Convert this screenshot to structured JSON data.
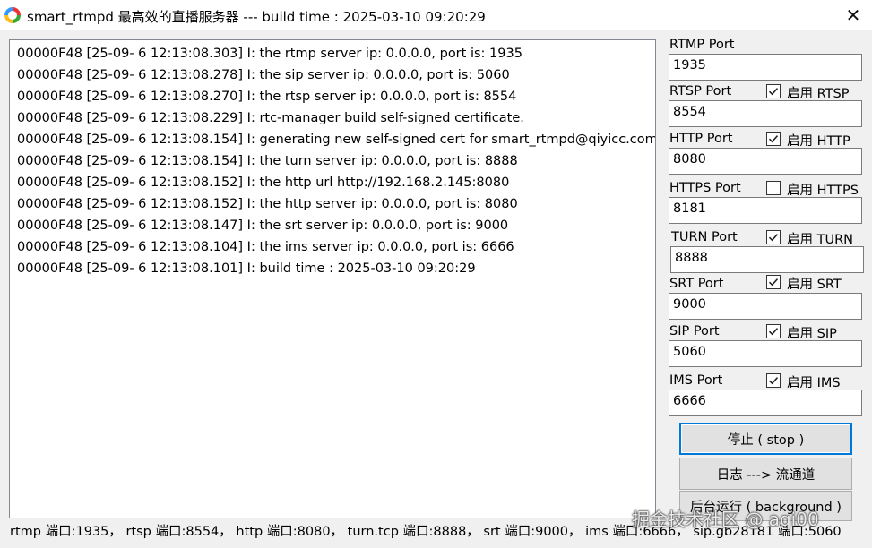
{
  "window": {
    "title": "smart_rtmpd 最高效的直播服务器 --- build time : 2025-03-10 09:20:29",
    "close_glyph": "✕"
  },
  "log": {
    "lines": [
      "00000F48 [25-09- 6 12:13:08.303] I: the rtmp server ip: 0.0.0.0, port is: 1935",
      "00000F48 [25-09- 6 12:13:08.278] I: the sip server ip: 0.0.0.0, port is: 5060",
      "00000F48 [25-09- 6 12:13:08.270] I: the rtsp server ip: 0.0.0.0, port is: 8554",
      "00000F48 [25-09- 6 12:13:08.229] I: rtc-manager build self-signed certificate.",
      "00000F48 [25-09- 6 12:13:08.154] I: generating new self-signed cert for smart_rtmpd@qiyicc.com",
      "00000F48 [25-09- 6 12:13:08.154] I: the turn server ip: 0.0.0.0, port is: 8888",
      "00000F48 [25-09- 6 12:13:08.152] I: the http url http://192.168.2.145:8080",
      "00000F48 [25-09- 6 12:13:08.152] I: the http server ip: 0.0.0.0, port is: 8080",
      "00000F48 [25-09- 6 12:13:08.147] I: the srt server ip: 0.0.0.0, port is: 9000",
      "00000F48 [25-09- 6 12:13:08.104] I: the ims server ip: 0.0.0.0, port is: 6666",
      "00000F48 [25-09- 6 12:13:08.101] I: build time : 2025-03-10 09:20:29"
    ]
  },
  "ports": {
    "rtmp": {
      "label": "RTMP Port",
      "value": "1935"
    },
    "rtsp": {
      "label": "RTSP Port",
      "value": "8554",
      "enable_label": "启用 RTSP",
      "enabled": true
    },
    "http": {
      "label": "HTTP Port",
      "value": "8080",
      "enable_label": "启用 HTTP",
      "enabled": true
    },
    "https": {
      "label": "HTTPS Port",
      "value": "8181",
      "enable_label": "启用 HTTPS",
      "enabled": false
    },
    "turn": {
      "label": "TURN Port",
      "value": "8888",
      "enable_label": "启用 TURN",
      "enabled": true
    },
    "srt": {
      "label": "SRT Port",
      "value": "9000",
      "enable_label": "启用 SRT",
      "enabled": true
    },
    "sip": {
      "label": "SIP Port",
      "value": "5060",
      "enable_label": "启用 SIP",
      "enabled": true
    },
    "ims": {
      "label": "IMS Port",
      "value": "6666",
      "enable_label": "启用 IMS",
      "enabled": true
    }
  },
  "buttons": {
    "stop": "停止 ( stop )",
    "log_stream": "日志 ---> 流通道",
    "background": "后台运行 ( background )"
  },
  "status_bar": "rtmp 端口:1935， rtsp 端口:8554， http 端口:8080， turn.tcp 端口:8888， srt 端口:9000， ims 端口:6666， sip.gb28181 端口:5060",
  "watermark": "掘金技术社区 @ aqi00",
  "colors": {
    "focus_border": "#0078d7",
    "window_bg": "#f0f0f0"
  }
}
